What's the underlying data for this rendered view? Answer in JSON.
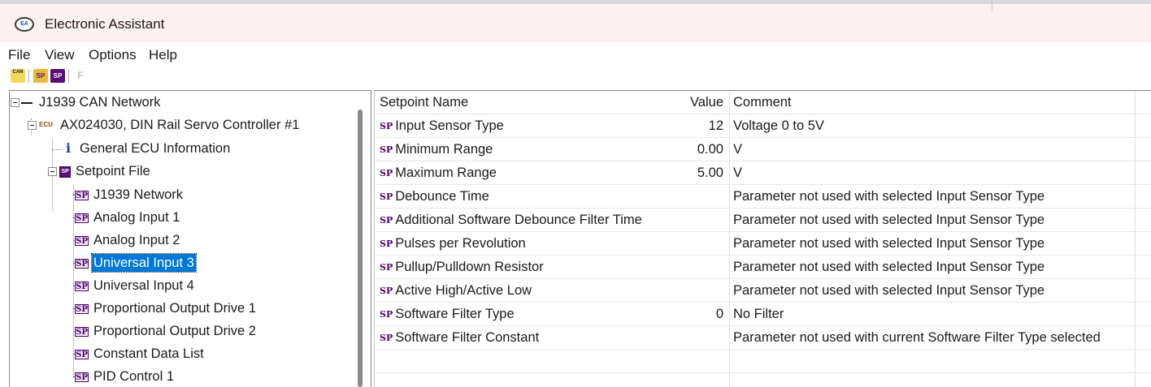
{
  "window": {
    "title": "Electronic Assistant"
  },
  "menu": {
    "items": [
      "File",
      "View",
      "Options",
      "Help"
    ]
  },
  "toolbar": {
    "buttons": [
      {
        "icon": "can-network-icon",
        "label": "CAN"
      },
      {
        "icon": "open-setpoint-file-icon",
        "label": "SP"
      },
      {
        "icon": "save-setpoint-file-icon",
        "label": "SP"
      },
      {
        "icon": "flash-icon",
        "label": "F"
      }
    ]
  },
  "tree": {
    "root": "J1939 CAN Network",
    "ecu": "AX024030, DIN Rail Servo Controller #1",
    "ecu_icon_text": "ECU",
    "info": "General ECU Information",
    "info_icon_text": "i",
    "setpoint_file": "Setpoint File",
    "items": [
      "J1939 Network",
      "Analog Input 1",
      "Analog Input 2",
      "Universal Input 3",
      "Universal Input 4",
      "Proportional Output Drive 1",
      "Proportional Output Drive 2",
      "Constant Data List",
      "PID Control 1"
    ],
    "selected": "Universal Input 3",
    "sp_icon_text": "SP"
  },
  "table": {
    "headers": {
      "name": "Setpoint Name",
      "value": "Value",
      "comment": "Comment"
    },
    "badge": "SP",
    "rows": [
      {
        "name": "Input Sensor Type",
        "value": "12",
        "comment": "Voltage 0 to 5V"
      },
      {
        "name": "Minimum Range",
        "value": "0.00",
        "comment": "V"
      },
      {
        "name": "Maximum Range",
        "value": "5.00",
        "comment": "V"
      },
      {
        "name": "Debounce Time",
        "value": "",
        "comment": "Parameter not used with selected Input Sensor Type"
      },
      {
        "name": "Additional Software Debounce Filter Time",
        "value": "",
        "comment": "Parameter not used with selected Input Sensor Type"
      },
      {
        "name": "Pulses per Revolution",
        "value": "",
        "comment": "Parameter not used with selected Input Sensor Type"
      },
      {
        "name": "Pullup/Pulldown Resistor",
        "value": "",
        "comment": "Parameter not used with selected Input Sensor Type"
      },
      {
        "name": "Active High/Active Low",
        "value": "",
        "comment": "Parameter not used with selected Input Sensor Type"
      },
      {
        "name": "Software Filter Type",
        "value": "0",
        "comment": "No Filter"
      },
      {
        "name": "Software Filter Constant",
        "value": "",
        "comment": "Parameter not used with current Software Filter Type selected"
      }
    ]
  }
}
